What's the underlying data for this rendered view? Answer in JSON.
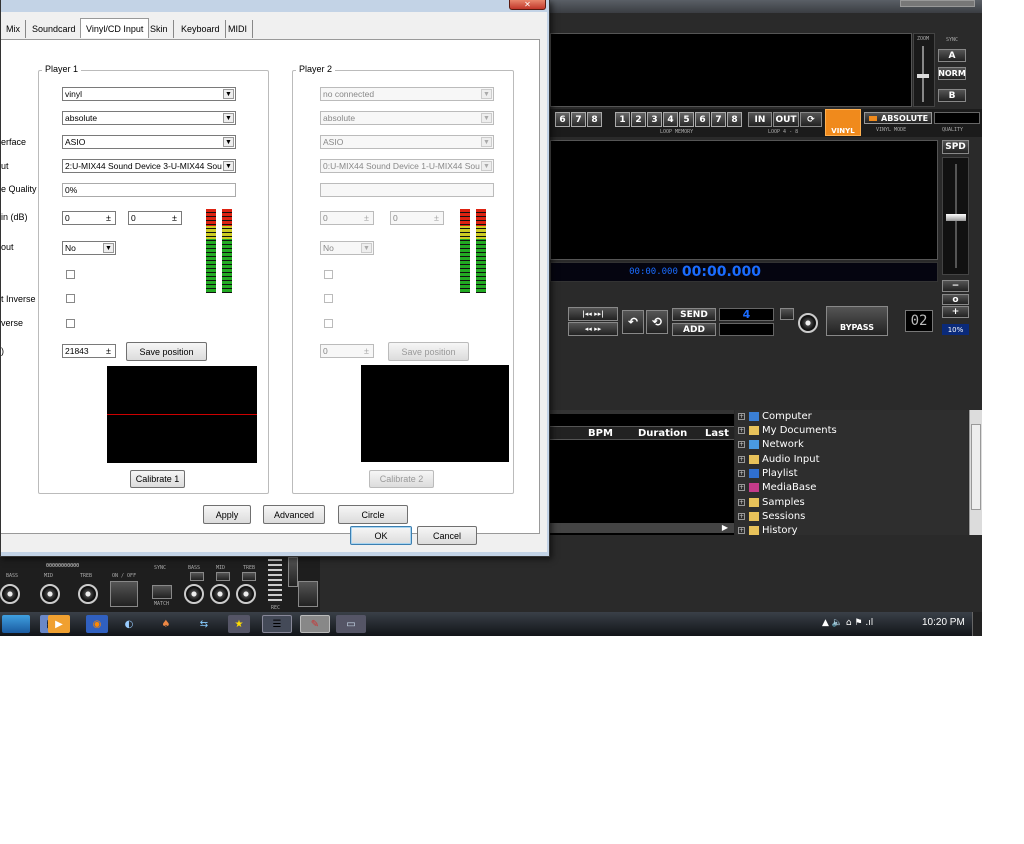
{
  "tabs": [
    "Mix",
    "Soundcard",
    "Vinyl/CD Input",
    "Skin",
    "Keyboard",
    "MIDI"
  ],
  "player1": {
    "title": "Player 1",
    "labels": [
      "erface",
      "ut",
      "e Quality",
      "in (dB)",
      "out",
      "",
      "t Inverse",
      "verse",
      ")"
    ],
    "vinyl": "vinyl",
    "mode": "absolute",
    "interface": "ASIO",
    "input": "2:U-MIX44 Sound Device 3-U-MIX44 Sou",
    "quality": "0%",
    "gain_left": "0",
    "gain_right": "0",
    "out": "No",
    "position": "21843",
    "save": "Save position",
    "calibrate": "Calibrate 1"
  },
  "player2": {
    "title": "Player 2",
    "vinyl": "no connected",
    "mode": "absolute",
    "interface": "ASIO",
    "input": "0:U-MIX44 Sound Device 1-U-MIX44 Sou",
    "quality": "",
    "gain_left": "0",
    "gain_right": "0",
    "out": "No",
    "position": "0",
    "save": "Save position",
    "calibrate": "Calibrate 2"
  },
  "buttons": {
    "apply": "Apply",
    "advanced": "Advanced",
    "circle": "Circle",
    "ok": "OK",
    "cancel": "Cancel",
    "close": "✕"
  },
  "deck": {
    "zoom": "ZOOM",
    "sync": "SYNC",
    "a": "A",
    "norm": "NORM",
    "b": "B",
    "nums_left": [
      "6",
      "7",
      "8"
    ],
    "nums_loop": [
      "1",
      "2",
      "3",
      "4",
      "5",
      "6",
      "7",
      "8"
    ],
    "loop_memory": "LOOP MEMORY",
    "in": "IN",
    "out": "OUT",
    "loop_range": "LOOP 4 - 8",
    "vinyl": "VINYL",
    "absolute": "ABSOLUTE",
    "vinyl_mode": "VINYL MODE",
    "quality": "QUALITY",
    "spd": "SPD",
    "time_small": "00:00.000",
    "time_big": "00:00.000",
    "send": "SEND",
    "add": "ADD",
    "counter": "4",
    "bypass": "BYPASS",
    "digits": "02",
    "pct": "10%",
    "minus": "−",
    "zero": "o",
    "plus": "+"
  },
  "browser": {
    "columns": [
      "BPM",
      "Duration",
      "Last"
    ],
    "tree": [
      "Computer",
      "My Documents",
      "Network",
      "Audio Input",
      "Playlist",
      "MediaBase",
      "Samples",
      "Sessions",
      "History"
    ]
  },
  "mixer": {
    "labels": [
      "BASS",
      "MID",
      "TREB",
      "ON / OFF",
      "SYNC",
      "BASS",
      "MID",
      "TREB",
      "MATCH",
      "REC"
    ],
    "counter": "00000000000"
  },
  "taskbar": {
    "clock": "10:20 PM"
  },
  "colors": {
    "accent_orange": "#f08a1c",
    "deck_blue": "#1a6cff",
    "dialog_border": "#c3d3e6"
  }
}
